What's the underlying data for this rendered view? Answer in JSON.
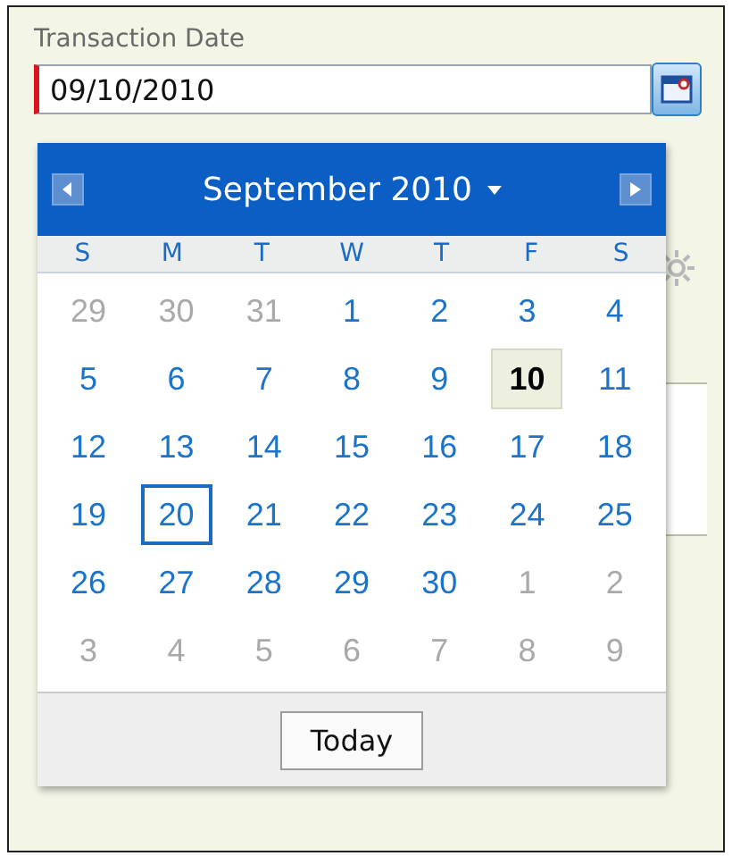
{
  "field": {
    "label": "Transaction Date",
    "value": "09/10/2010",
    "required": true
  },
  "calendar": {
    "month_title": "September 2010",
    "weekdays": [
      "S",
      "M",
      "T",
      "W",
      "T",
      "F",
      "S"
    ],
    "weeks": [
      [
        {
          "day": "29",
          "other_month": true,
          "selected": false,
          "today": false
        },
        {
          "day": "30",
          "other_month": true,
          "selected": false,
          "today": false
        },
        {
          "day": "31",
          "other_month": true,
          "selected": false,
          "today": false
        },
        {
          "day": "1",
          "other_month": false,
          "selected": false,
          "today": false
        },
        {
          "day": "2",
          "other_month": false,
          "selected": false,
          "today": false
        },
        {
          "day": "3",
          "other_month": false,
          "selected": false,
          "today": false
        },
        {
          "day": "4",
          "other_month": false,
          "selected": false,
          "today": false
        }
      ],
      [
        {
          "day": "5",
          "other_month": false,
          "selected": false,
          "today": false
        },
        {
          "day": "6",
          "other_month": false,
          "selected": false,
          "today": false
        },
        {
          "day": "7",
          "other_month": false,
          "selected": false,
          "today": false
        },
        {
          "day": "8",
          "other_month": false,
          "selected": false,
          "today": false
        },
        {
          "day": "9",
          "other_month": false,
          "selected": false,
          "today": false
        },
        {
          "day": "10",
          "other_month": false,
          "selected": true,
          "today": false
        },
        {
          "day": "11",
          "other_month": false,
          "selected": false,
          "today": false
        }
      ],
      [
        {
          "day": "12",
          "other_month": false,
          "selected": false,
          "today": false
        },
        {
          "day": "13",
          "other_month": false,
          "selected": false,
          "today": false
        },
        {
          "day": "14",
          "other_month": false,
          "selected": false,
          "today": false
        },
        {
          "day": "15",
          "other_month": false,
          "selected": false,
          "today": false
        },
        {
          "day": "16",
          "other_month": false,
          "selected": false,
          "today": false
        },
        {
          "day": "17",
          "other_month": false,
          "selected": false,
          "today": false
        },
        {
          "day": "18",
          "other_month": false,
          "selected": false,
          "today": false
        }
      ],
      [
        {
          "day": "19",
          "other_month": false,
          "selected": false,
          "today": false
        },
        {
          "day": "20",
          "other_month": false,
          "selected": false,
          "today": true
        },
        {
          "day": "21",
          "other_month": false,
          "selected": false,
          "today": false
        },
        {
          "day": "22",
          "other_month": false,
          "selected": false,
          "today": false
        },
        {
          "day": "23",
          "other_month": false,
          "selected": false,
          "today": false
        },
        {
          "day": "24",
          "other_month": false,
          "selected": false,
          "today": false
        },
        {
          "day": "25",
          "other_month": false,
          "selected": false,
          "today": false
        }
      ],
      [
        {
          "day": "26",
          "other_month": false,
          "selected": false,
          "today": false
        },
        {
          "day": "27",
          "other_month": false,
          "selected": false,
          "today": false
        },
        {
          "day": "28",
          "other_month": false,
          "selected": false,
          "today": false
        },
        {
          "day": "29",
          "other_month": false,
          "selected": false,
          "today": false
        },
        {
          "day": "30",
          "other_month": false,
          "selected": false,
          "today": false
        },
        {
          "day": "1",
          "other_month": true,
          "selected": false,
          "today": false
        },
        {
          "day": "2",
          "other_month": true,
          "selected": false,
          "today": false
        }
      ],
      [
        {
          "day": "3",
          "other_month": true,
          "selected": false,
          "today": false
        },
        {
          "day": "4",
          "other_month": true,
          "selected": false,
          "today": false
        },
        {
          "day": "5",
          "other_month": true,
          "selected": false,
          "today": false
        },
        {
          "day": "6",
          "other_month": true,
          "selected": false,
          "today": false
        },
        {
          "day": "7",
          "other_month": true,
          "selected": false,
          "today": false
        },
        {
          "day": "8",
          "other_month": true,
          "selected": false,
          "today": false
        },
        {
          "day": "9",
          "other_month": true,
          "selected": false,
          "today": false
        }
      ]
    ],
    "today_button": "Today"
  }
}
